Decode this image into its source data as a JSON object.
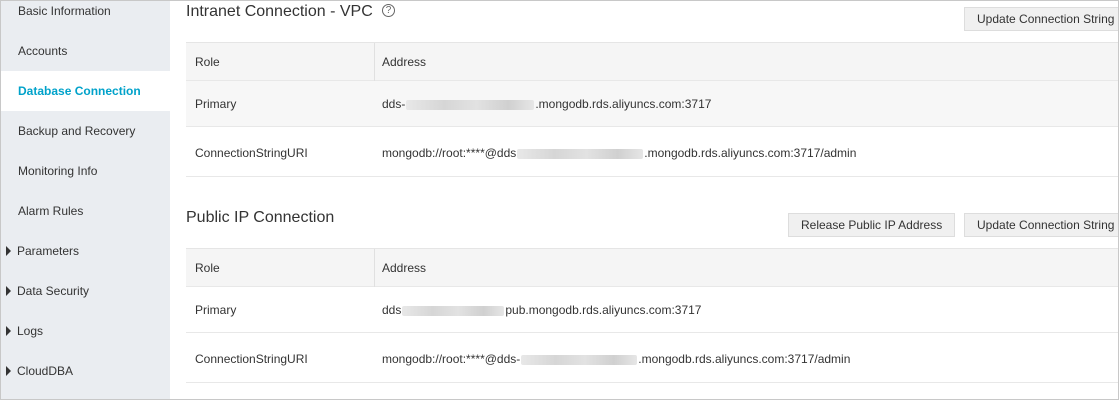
{
  "sidebar": {
    "items": [
      {
        "label": "Basic Information"
      },
      {
        "label": "Accounts"
      },
      {
        "label": "Database Connection"
      },
      {
        "label": "Backup and Recovery"
      },
      {
        "label": "Monitoring Info"
      },
      {
        "label": "Alarm Rules"
      },
      {
        "label": "Parameters"
      },
      {
        "label": "Data Security"
      },
      {
        "label": "Logs"
      },
      {
        "label": "CloudDBA"
      }
    ],
    "active_color": "#00a2ca"
  },
  "vpc": {
    "title": "Intranet Connection - VPC",
    "help_glyph": "?",
    "update_button": "Update Connection String",
    "headers": {
      "role": "Role",
      "address": "Address"
    },
    "rows": [
      {
        "role": "Primary",
        "prefix": "dds-",
        "suffix": ".mongodb.rds.aliyuncs.com:3717"
      },
      {
        "role": "ConnectionStringURI",
        "prefix": "mongodb://root:****@dds",
        "suffix": ".mongodb.rds.aliyuncs.com:3717/admin"
      }
    ]
  },
  "public": {
    "title": "Public IP Connection",
    "release_button": "Release Public IP Address",
    "update_button": "Update Connection String",
    "headers": {
      "role": "Role",
      "address": "Address"
    },
    "rows": [
      {
        "role": "Primary",
        "prefix": "dds",
        "suffix": "pub.mongodb.rds.aliyuncs.com:3717"
      },
      {
        "role": "ConnectionStringURI",
        "prefix": "mongodb://root:****@dds-",
        "suffix": ".mongodb.rds.aliyuncs.com:3717/admin"
      }
    ]
  }
}
